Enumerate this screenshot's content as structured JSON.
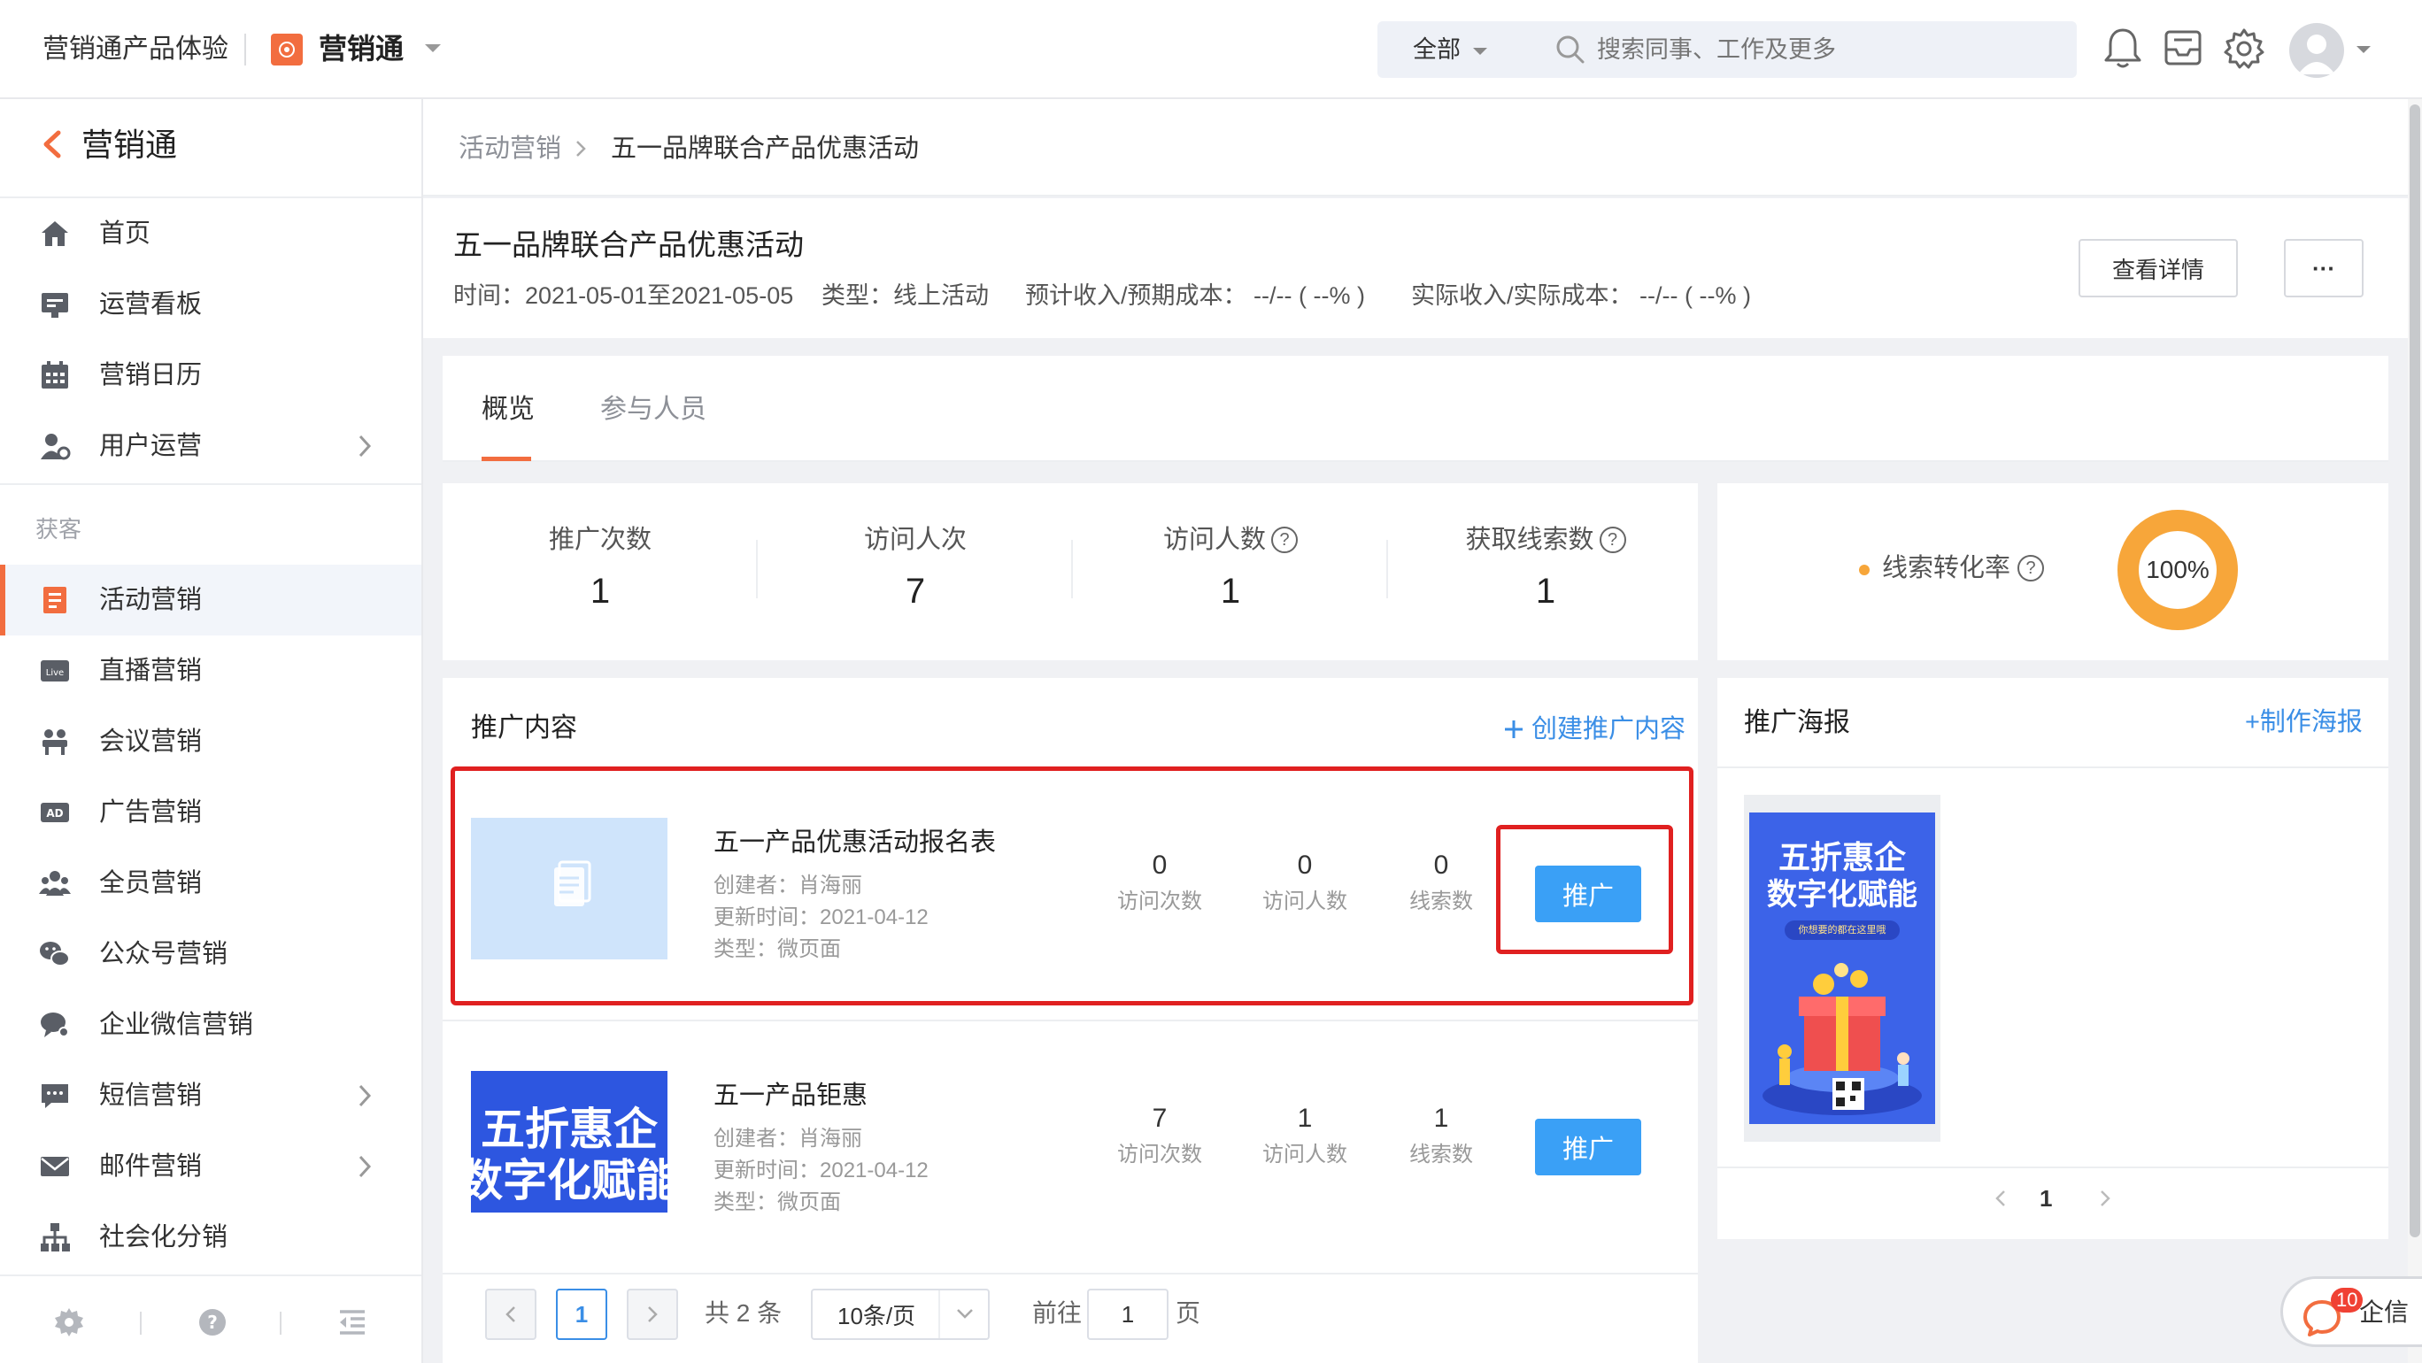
{
  "topbar": {
    "brand": "营销通产品体验",
    "app_name": "营销通",
    "search_scope": "全部",
    "search_placeholder": "搜索同事、工作及更多"
  },
  "sidebar": {
    "title": "营销通",
    "items_top": [
      {
        "label": "首页",
        "icon": "home-icon"
      },
      {
        "label": "运营看板",
        "icon": "dashboard-icon"
      },
      {
        "label": "营销日历",
        "icon": "calendar-icon"
      },
      {
        "label": "用户运营",
        "icon": "user-ops-icon",
        "has_children": true
      }
    ],
    "group_label": "获客",
    "items": [
      {
        "label": "活动营销",
        "icon": "event-icon",
        "active": true
      },
      {
        "label": "直播营销",
        "icon": "live-icon"
      },
      {
        "label": "会议营销",
        "icon": "meeting-icon"
      },
      {
        "label": "广告营销",
        "icon": "ad-icon"
      },
      {
        "label": "全员营销",
        "icon": "team-icon"
      },
      {
        "label": "公众号营销",
        "icon": "wechat-icon"
      },
      {
        "label": "企业微信营销",
        "icon": "wecom-icon"
      },
      {
        "label": "短信营销",
        "icon": "sms-icon",
        "has_children": true
      },
      {
        "label": "邮件营销",
        "icon": "mail-icon",
        "has_children": true
      },
      {
        "label": "社会化分销",
        "icon": "distribution-icon"
      }
    ]
  },
  "breadcrumb": {
    "parent": "活动营销",
    "current": "五一品牌联合产品优惠活动"
  },
  "activity": {
    "title": "五一品牌联合产品优惠活动",
    "time": "时间：2021-05-01至2021-05-05",
    "type": "类型：线上活动",
    "expected": "预计收入/预期成本： --/-- ( --% )",
    "actual": "实际收入/实际成本： --/-- ( --% )",
    "detail_button": "查看详情",
    "more_button": "···"
  },
  "tabs": [
    {
      "label": "概览",
      "active": true
    },
    {
      "label": "参与人员",
      "active": false
    }
  ],
  "stats": [
    {
      "label": "推广次数",
      "value": "1",
      "help": false
    },
    {
      "label": "访问人次",
      "value": "7",
      "help": false
    },
    {
      "label": "访问人数",
      "value": "1",
      "help": true
    },
    {
      "label": "获取线索数",
      "value": "1",
      "help": true
    }
  ],
  "conversion": {
    "label": "线索转化率",
    "value_text": "100%",
    "ratio": 1.0,
    "color": "#f7a63a"
  },
  "promo": {
    "title": "推广内容",
    "create_link": "创建推广内容",
    "rows": [
      {
        "title": "五一产品优惠活动报名表",
        "creator": "创建者：肖海丽",
        "updated": "更新时间：2021-04-12",
        "type": "类型：微页面",
        "visits": "0",
        "visits_label": "访问次数",
        "visitors": "0",
        "visitors_label": "访问人数",
        "leads": "0",
        "leads_label": "线索数",
        "button": "推广"
      },
      {
        "title": "五一产品钜惠",
        "creator": "创建者：肖海丽",
        "updated": "更新时间：2021-04-12",
        "type": "类型：微页面",
        "visits": "7",
        "visits_label": "访问次数",
        "visitors": "1",
        "visitors_label": "访问人数",
        "leads": "1",
        "leads_label": "线索数",
        "button": "推广",
        "thumb_line1": "五折惠企",
        "thumb_line2": "数字化赋能"
      }
    ],
    "pager": {
      "current": "1",
      "total": "共 2 条",
      "page_size": "10条/页",
      "goto_label": "前往",
      "goto_value": "1",
      "page_unit": "页"
    }
  },
  "poster": {
    "title": "推广海报",
    "create_link": "+制作海报",
    "poster_line1": "五折惠企",
    "poster_line2": "数字化赋能",
    "poster_tagline": "你想要的都在这里哦",
    "page": "1"
  },
  "qixin": {
    "badge": "10",
    "label": "企信"
  },
  "colors": {
    "accent": "#f26d3f",
    "primary": "#3aa0f6",
    "link": "#3a8ee6",
    "highlight": "#e02020"
  }
}
